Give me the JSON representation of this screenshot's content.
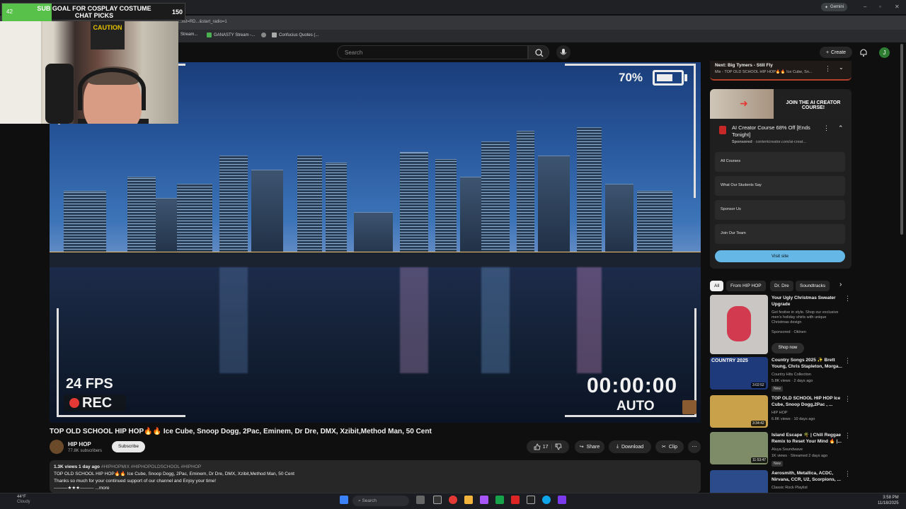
{
  "stream_overlay": {
    "goal_count": "42",
    "goal_text": "SUB GOAL FOR COSPLAY COSTUME CHAT PICKS",
    "goal_max": "150",
    "poster_text": "CAUTION"
  },
  "browser": {
    "url": "...list=RD...&start_radio=1",
    "gemini_label": "Gemini",
    "bookmarks": [
      "Stream...",
      "GANASTY Stream -...",
      "Confucius Quotes (..."
    ]
  },
  "youtube_header": {
    "search_placeholder": "Search",
    "create_label": "Create",
    "avatar_letter": "J"
  },
  "video": {
    "battery_percent": "70%",
    "battery_level": 0.7,
    "fps": "24 FPS",
    "rec": "REC",
    "timer": "00:00:00",
    "mode": "AUTO"
  },
  "video_info": {
    "title": "TOP OLD SCHOOL HIP HOP🔥🔥 Ice Cube, Snoop Dogg, 2Pac, Eminem, Dr Dre, DMX, Xzibit,Method Man, 50 Cent",
    "channel_name": "HIP HOP",
    "channel_subs": "77.8K subscribers",
    "subscribe_label": "Subscribe",
    "likes": "17",
    "share_label": "Share",
    "download_label": "Download",
    "clip_label": "Clip",
    "more_actions": "⋯",
    "desc_meta": "1.3K views  1 day ago",
    "desc_tags": "#HIPHOPMIX #HIPHOPOLDSCHOOL #HIPHOP",
    "desc_line1": "TOP OLD SCHOOL HIP HOP🔥🔥 Ice Cube, Snoop Dogg, 2Pac, Eminem, Dr Dre, DMX, Xzibit,Method Man, 50 Cent",
    "desc_line2": "Thanks so much for your continued support of our channel and Enjoy your time!",
    "desc_line3": "———★★★———",
    "more_label": "...more"
  },
  "sidebar": {
    "next_label": "Next: Big Tymers - Still Fly",
    "next_sub": "Mix - TOP OLD SCHOOL HIP HOP🔥🔥 Ice Cube, Sn...",
    "ad_banner": "JOIN THE AI CREATOR COURSE!",
    "ad_title": "AI Creator Course 68% Off [Ends Tonight]",
    "ad_sponsored": "Sponsored",
    "ad_domain": "contentcreator.com/ai-creat...",
    "ad_links": [
      "All Courses",
      "What Our Students Say",
      "Sponsor Us",
      "Join Our Team"
    ],
    "visit_label": "Visit site",
    "chips": [
      "All",
      "From HIP HOP",
      "Dr. Dre",
      "Soundtracks"
    ],
    "recs": [
      {
        "title": "Your Ugly Christmas Sweater Upgrade",
        "line1": "Get festive in style. Shop our exclusive men's holiday shirts with unique Christmas design",
        "line2": "Sponsored · Oklnen",
        "cta": "Shop now",
        "color": "#c9c6c3"
      },
      {
        "title": "Country Songs 2025 ✨ Brett Young, Chris Stapleton, Morga...",
        "line1": "Country Hits Collection",
        "line2": "5.8K views · 2 days ago",
        "badge": "New",
        "duration": "3:02:52",
        "color": "#1f3a7a"
      },
      {
        "title": "TOP OLD SCHOOL HIP HOP Ice Cube, Snoop Dogg,2Pac , ...",
        "line1": "HIP HOP",
        "line2": "6.8K views · 10 days ago",
        "duration": "3:34:42",
        "color": "#c9a14a"
      },
      {
        "title": "Island Escape 🌴 | Chill Reggae Remix to Reset Your Mind 🔥 |...",
        "line1": "Aluya Soundwave",
        "line2": "1K views · Streamed 2 days ago",
        "badge": "New",
        "duration": "11:53:47",
        "color": "#7e8c68"
      },
      {
        "title": "Aerosmith, Metallica, ACDC, Nirvana, CCR, U2, Scorpions, ...",
        "line1": "Classic Rock Playlist",
        "line2": "",
        "color": "#2b4b8a"
      }
    ]
  },
  "taskbar": {
    "weather_temp": "44°F",
    "weather_desc": "Cloudy",
    "search_label": "Search",
    "time": "3:58 PM",
    "date": "11/18/2025"
  }
}
